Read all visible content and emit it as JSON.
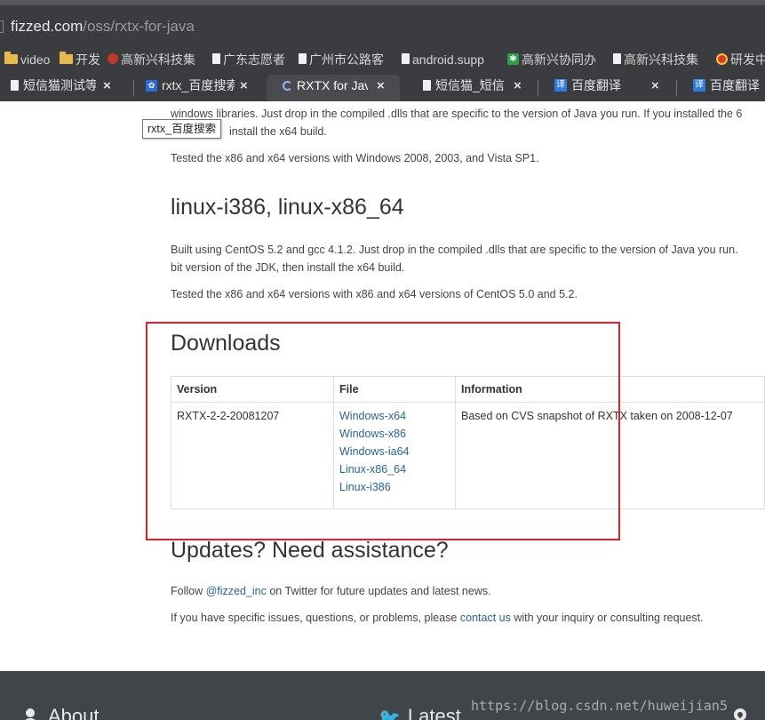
{
  "browser": {
    "address": {
      "host": "fizzed.com",
      "path": "/oss/rxtx-for-java"
    },
    "bookmarks": [
      {
        "label": "video",
        "icon": "folder-icon"
      },
      {
        "label": "开发",
        "icon": "folder-icon"
      },
      {
        "label": "高新兴科技集",
        "icon": "red-circle-icon"
      },
      {
        "label": "广东志愿者",
        "icon": "page-icon"
      },
      {
        "label": "广州市公路客",
        "icon": "page-icon"
      },
      {
        "label": "android.supp",
        "icon": "page-icon"
      },
      {
        "label": "高新兴协同办",
        "icon": "green-square-icon"
      },
      {
        "label": "高新兴科技集",
        "icon": "page-icon"
      },
      {
        "label": "研发中",
        "icon": "emblem-icon"
      }
    ],
    "tabs": [
      {
        "title": "短信猫测试等",
        "icon": "page-icon",
        "active": false
      },
      {
        "title": "rxtx_百度搜索",
        "icon": "baidu-paw-icon",
        "active": false
      },
      {
        "title": "RXTX for Java",
        "icon": "loading-icon",
        "active": true
      },
      {
        "title": "短信猫_短信",
        "icon": "page-icon",
        "active": false
      },
      {
        "title": "百度翻译",
        "icon": "translate-icon",
        "active": false
      },
      {
        "title": "百度翻译",
        "icon": "translate-icon",
        "active": false
      }
    ],
    "tab_close_glyph": "×",
    "tooltip": "rxtx_百度搜索"
  },
  "page": {
    "intro_line1": "windows libraries. Just drop in the compiled .dlls that are specific to the version of Java you run. If you installed the 6",
    "intro_line2": "install the x64 build.",
    "windows_tested": "Tested the x86 and x64 versions with Windows 2008, 2003, and Vista SP1.",
    "linux_heading": "linux-i386, linux-x86_64",
    "linux_line1": "Built using CentOS 5.2 and gcc 4.1.2. Just drop in the compiled .dlls that are specific to the version of Java you run.",
    "linux_line2": "bit version of the JDK, then install the x64 build.",
    "linux_tested": "Tested the x86 and x64 versions with x86 and x64 versions of CentOS 5.0 and 5.2.",
    "downloads_heading": "Downloads",
    "table": {
      "headers": [
        "Version",
        "File",
        "Information"
      ],
      "rows": [
        {
          "version": "RXTX-2-2-20081207",
          "files": [
            "Windows-x64",
            "Windows-x86",
            "Windows-ia64",
            "Linux-x86_64",
            "Linux-i386"
          ],
          "information": "Based on CVS snapshot of RXTX taken on 2008-12-07"
        }
      ]
    },
    "updates_heading": "Updates? Need assistance?",
    "follow_prefix": "Follow ",
    "follow_link": "@fizzed_inc",
    "follow_suffix": " on Twitter for future updates and latest news.",
    "issues_prefix": "If you have specific issues, questions, or problems, please ",
    "issues_link": "contact us",
    "issues_suffix": " with your inquiry or consulting request."
  },
  "footer": {
    "about": "About",
    "latest": "Latest",
    "watermark": "https://blog.csdn.net/huweijian5"
  },
  "colors": {
    "chrome_bg": "#3b3c3f",
    "link": "#2a6496",
    "highlight_border": "#d9232b",
    "footer_bg": "#3f4549"
  }
}
